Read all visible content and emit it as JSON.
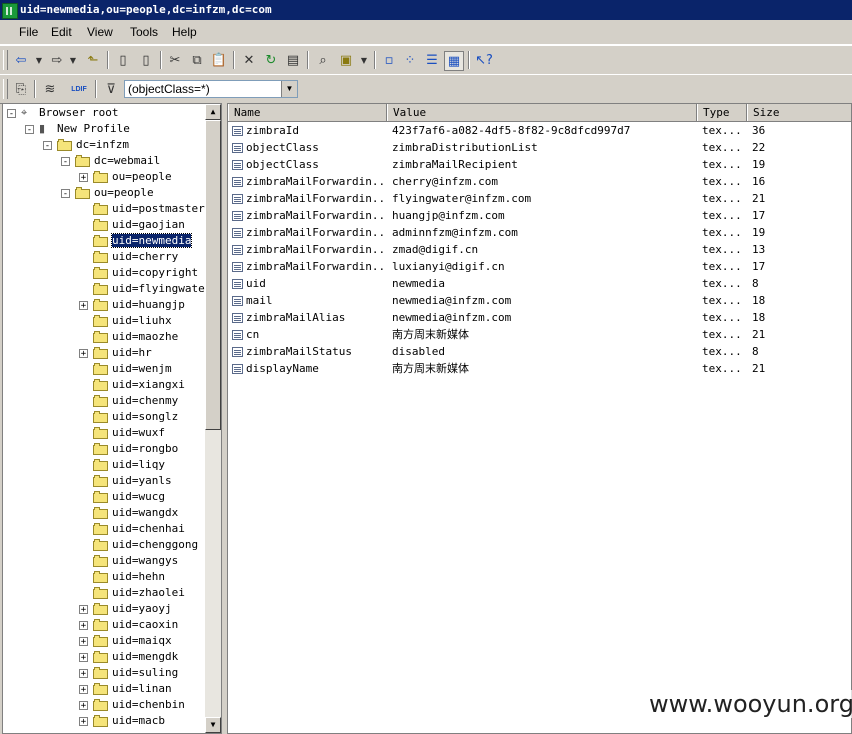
{
  "window": {
    "title": "uid=newmedia,ou=people,dc=infzm,dc=com"
  },
  "menu": [
    "File",
    "Edit",
    "View",
    "Tools",
    "Help"
  ],
  "filter": {
    "value": "(objectClass=*)"
  },
  "toolbar2": {
    "ldif_label": "LDIF"
  },
  "tree": {
    "root": "Browser root",
    "profile": "New Profile",
    "base": "dc=infzm",
    "webmail": "dc=webmail",
    "webmail_people": "ou=people",
    "people": "ou=people",
    "entries": [
      {
        "label": "uid=postmaster",
        "expandable": false
      },
      {
        "label": "uid=gaojian",
        "expandable": false
      },
      {
        "label": "uid=newmedia",
        "expandable": false,
        "selected": true
      },
      {
        "label": "uid=cherry",
        "expandable": false
      },
      {
        "label": "uid=copyright",
        "expandable": false
      },
      {
        "label": "uid=flyingwater",
        "expandable": false
      },
      {
        "label": "uid=huangjp",
        "expandable": true
      },
      {
        "label": "uid=liuhx",
        "expandable": false
      },
      {
        "label": "uid=maozhe",
        "expandable": false
      },
      {
        "label": "uid=hr",
        "expandable": true
      },
      {
        "label": "uid=wenjm",
        "expandable": false
      },
      {
        "label": "uid=xiangxi",
        "expandable": false
      },
      {
        "label": "uid=chenmy",
        "expandable": false
      },
      {
        "label": "uid=songlz",
        "expandable": false
      },
      {
        "label": "uid=wuxf",
        "expandable": false
      },
      {
        "label": "uid=rongbo",
        "expandable": false
      },
      {
        "label": "uid=liqy",
        "expandable": false
      },
      {
        "label": "uid=yanls",
        "expandable": false
      },
      {
        "label": "uid=wucg",
        "expandable": false
      },
      {
        "label": "uid=wangdx",
        "expandable": false
      },
      {
        "label": "uid=chenhai",
        "expandable": false
      },
      {
        "label": "uid=chenggong",
        "expandable": false
      },
      {
        "label": "uid=wangys",
        "expandable": false
      },
      {
        "label": "uid=hehn",
        "expandable": false
      },
      {
        "label": "uid=zhaolei",
        "expandable": false
      },
      {
        "label": "uid=yaoyj",
        "expandable": true
      },
      {
        "label": "uid=caoxin",
        "expandable": true
      },
      {
        "label": "uid=maiqx",
        "expandable": true
      },
      {
        "label": "uid=mengdk",
        "expandable": true
      },
      {
        "label": "uid=suling",
        "expandable": true
      },
      {
        "label": "uid=linan",
        "expandable": true
      },
      {
        "label": "uid=chenbin",
        "expandable": true
      },
      {
        "label": "uid=macb",
        "expandable": true
      }
    ]
  },
  "grid": {
    "columns": [
      "Name",
      "Value",
      "Type",
      "Size"
    ],
    "rows": [
      {
        "name": "zimbraId",
        "value": "423f7af6-a082-4df5-8f82-9c8dfcd997d7",
        "type": "tex...",
        "size": "36"
      },
      {
        "name": "objectClass",
        "value": "zimbraDistributionList",
        "type": "tex...",
        "size": "22"
      },
      {
        "name": "objectClass",
        "value": "zimbraMailRecipient",
        "type": "tex...",
        "size": "19"
      },
      {
        "name": "zimbraMailForwardin...",
        "value": "cherry@infzm.com",
        "type": "tex...",
        "size": "16"
      },
      {
        "name": "zimbraMailForwardin...",
        "value": "flyingwater@infzm.com",
        "type": "tex...",
        "size": "21"
      },
      {
        "name": "zimbraMailForwardin...",
        "value": "huangjp@infzm.com",
        "type": "tex...",
        "size": "17"
      },
      {
        "name": "zimbraMailForwardin...",
        "value": "adminnfzm@infzm.com",
        "type": "tex...",
        "size": "19"
      },
      {
        "name": "zimbraMailForwardin...",
        "value": "zmad@digif.cn",
        "type": "tex...",
        "size": "13"
      },
      {
        "name": "zimbraMailForwardin...",
        "value": "luxianyi@digif.cn",
        "type": "tex...",
        "size": "17"
      },
      {
        "name": "uid",
        "value": "newmedia",
        "type": "tex...",
        "size": "8"
      },
      {
        "name": "mail",
        "value": "newmedia@infzm.com",
        "type": "tex...",
        "size": "18"
      },
      {
        "name": "zimbraMailAlias",
        "value": "newmedia@infzm.com",
        "type": "tex...",
        "size": "18"
      },
      {
        "name": "cn",
        "value": "南方周末新媒体",
        "type": "tex...",
        "size": "21"
      },
      {
        "name": "zimbraMailStatus",
        "value": "disabled",
        "type": "tex...",
        "size": "8"
      },
      {
        "name": "displayName",
        "value": "南方周末新媒体",
        "type": "tex...",
        "size": "21"
      }
    ]
  },
  "watermark": "www.wooyun.org"
}
